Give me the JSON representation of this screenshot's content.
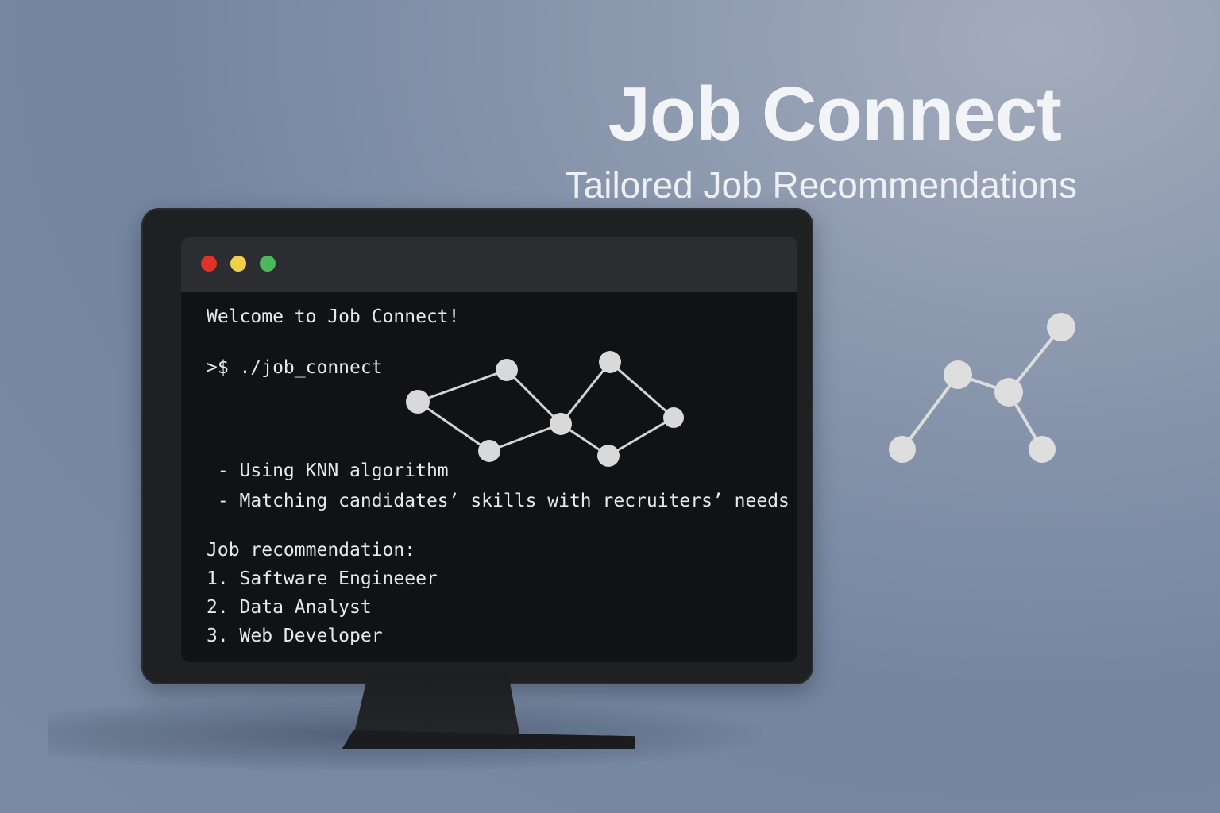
{
  "hero": {
    "title": "Job Connect",
    "subtitle": "Tailored Job Recommendations"
  },
  "window": {
    "controls": [
      "close",
      "minimize",
      "maximize"
    ],
    "control_colors": {
      "close": "#e0312b",
      "minimize": "#f2cf4a",
      "maximize": "#4cb85c"
    }
  },
  "terminal": {
    "welcome": "Welcome to Job Connect!",
    "command": ">$ ./job_connect",
    "notes": [
      " - Using KNN algorithm",
      " - Matching candidates’ skills with recruiters’ needs"
    ],
    "rec_heading": "Job recommendation:",
    "recommendations": [
      "1. Saftware Engineeer",
      "2. Data Analyst",
      "3. Web Developer"
    ]
  },
  "icons": {
    "screen_graph": "network-graph-icon",
    "side_graph": "network-graph-icon"
  },
  "colors": {
    "background": "#8a97ad",
    "monitor": "#1f2022",
    "screen": "#111214",
    "text": "#e9e9e9",
    "node": "#d9d9d9"
  }
}
